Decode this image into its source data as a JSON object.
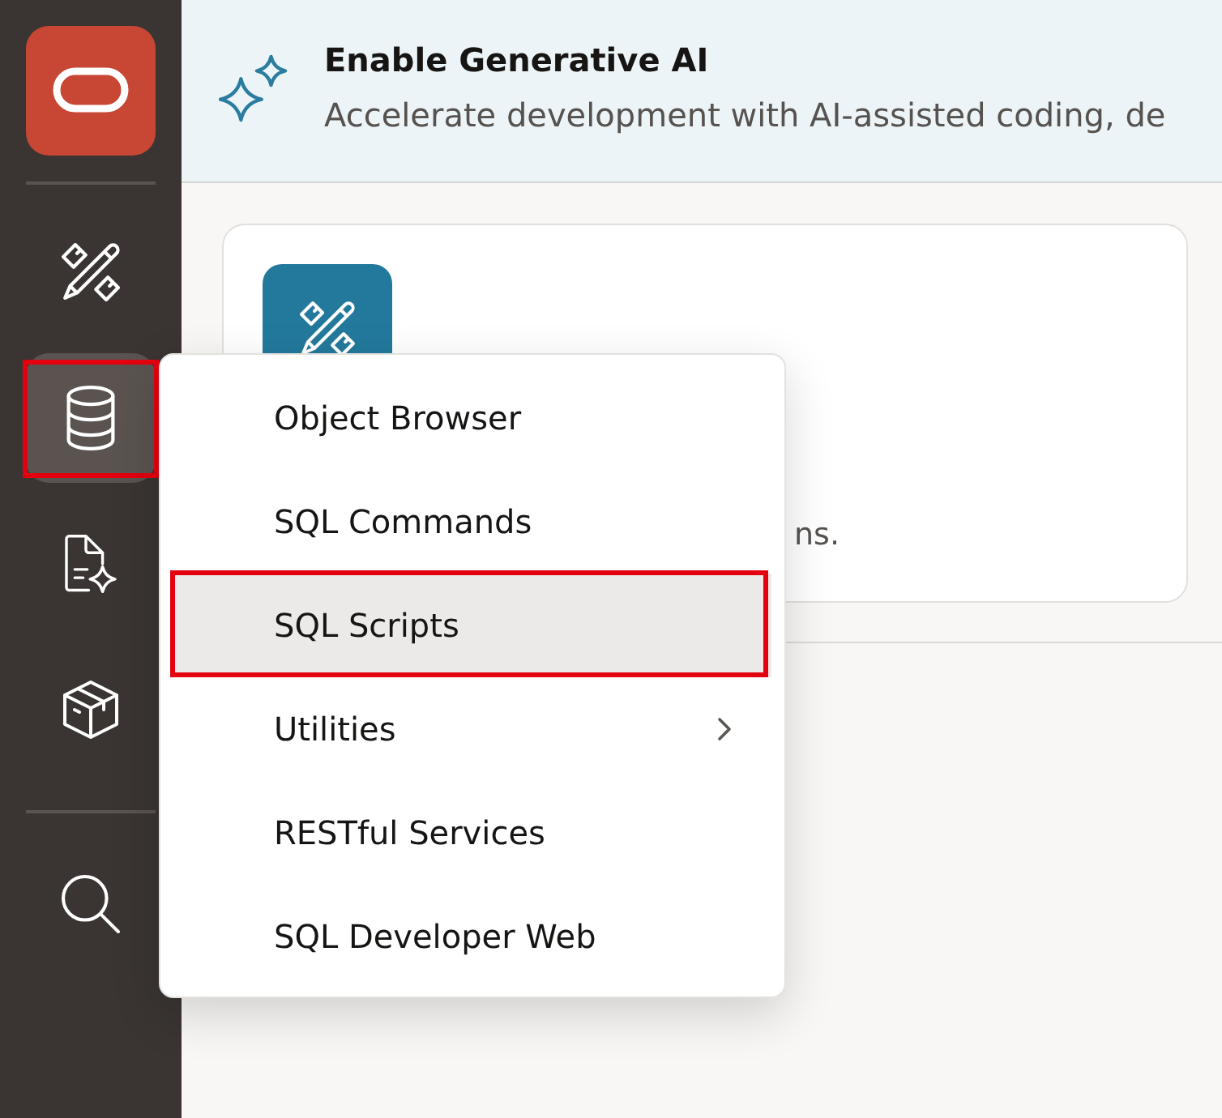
{
  "sidebar": {
    "items": [
      {
        "selected": false,
        "highlighted": false
      },
      {
        "selected": true,
        "highlighted": true
      },
      {
        "selected": false,
        "highlighted": false
      },
      {
        "selected": false,
        "highlighted": false
      },
      {
        "selected": false,
        "highlighted": false
      }
    ]
  },
  "banner": {
    "title": "Enable Generative AI",
    "subtitle": "Accelerate development with AI-assisted coding, de"
  },
  "card": {
    "description": "ns."
  },
  "menu": {
    "items": [
      {
        "label": "Object Browser",
        "selected": false,
        "highlighted": false,
        "submenu": false
      },
      {
        "label": "SQL Commands",
        "selected": false,
        "highlighted": false,
        "submenu": false
      },
      {
        "label": "SQL Scripts",
        "selected": true,
        "highlighted": true,
        "submenu": false
      },
      {
        "label": "Utilities",
        "selected": false,
        "highlighted": false,
        "submenu": true
      },
      {
        "label": "RESTful Services",
        "selected": false,
        "highlighted": false,
        "submenu": false
      },
      {
        "label": "SQL Developer Web",
        "selected": false,
        "highlighted": false,
        "submenu": false
      }
    ]
  }
}
